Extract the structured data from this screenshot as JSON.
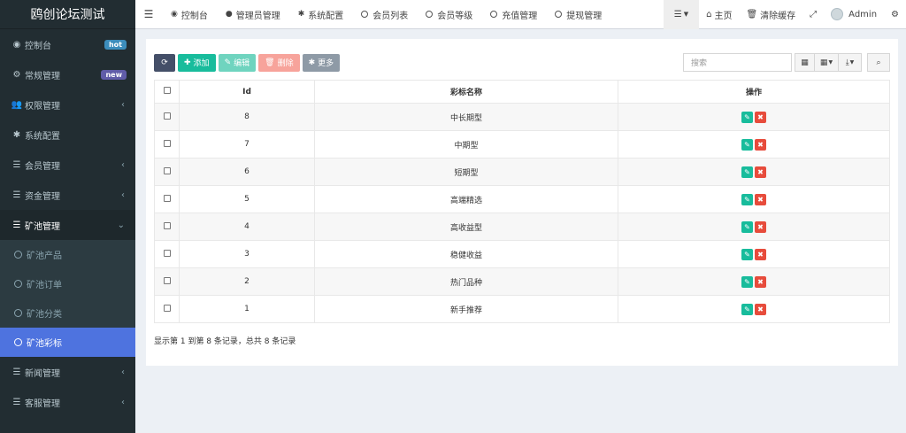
{
  "app": {
    "title": "鸥创论坛测试"
  },
  "sidebar": {
    "items": [
      {
        "label": "控制台",
        "icon": "dashboard-icon",
        "badge": "hot"
      },
      {
        "label": "常规管理",
        "icon": "cogs-icon",
        "badge": "new"
      },
      {
        "label": "权限管理",
        "icon": "users-icon",
        "arrow": "‹"
      },
      {
        "label": "系统配置",
        "icon": "gear-icon"
      },
      {
        "label": "会员管理",
        "icon": "list-icon",
        "arrow": "‹"
      },
      {
        "label": "资金管理",
        "icon": "list-icon",
        "arrow": "‹"
      },
      {
        "label": "矿池管理",
        "icon": "list-icon",
        "arrow": "⌄"
      }
    ],
    "submenu": [
      {
        "label": "矿池产品"
      },
      {
        "label": "矿池订单"
      },
      {
        "label": "矿池分类"
      },
      {
        "label": "矿池彩标"
      }
    ],
    "bottom_items": [
      {
        "label": "新闻管理",
        "icon": "list-icon",
        "arrow": "‹"
      },
      {
        "label": "客服管理",
        "icon": "list-icon",
        "arrow": "‹"
      }
    ]
  },
  "topnav": {
    "tabs": [
      {
        "label": "控制台",
        "icon": "dashboard-icon"
      },
      {
        "label": "管理员管理",
        "icon": "user-icon"
      },
      {
        "label": "系统配置",
        "icon": "gear-icon"
      },
      {
        "label": "会员列表",
        "icon": "circle-icon"
      },
      {
        "label": "会员等级",
        "icon": "circle-icon"
      },
      {
        "label": "充值管理",
        "icon": "circle-icon"
      },
      {
        "label": "提现管理",
        "icon": "circle-icon"
      }
    ],
    "right": {
      "home": "主页",
      "clear_cache": "清除缓存",
      "user": "Admin"
    }
  },
  "toolbar": {
    "add": "添加",
    "edit": "编辑",
    "delete": "删除",
    "more": "更多",
    "search_placeholder": "搜索"
  },
  "table": {
    "columns": [
      "Id",
      "彩标名称",
      "操作"
    ],
    "rows": [
      {
        "id": "8",
        "name": "中长期型"
      },
      {
        "id": "7",
        "name": "中期型"
      },
      {
        "id": "6",
        "name": "短期型"
      },
      {
        "id": "5",
        "name": "高端精选"
      },
      {
        "id": "4",
        "name": "高收益型"
      },
      {
        "id": "3",
        "name": "稳健收益"
      },
      {
        "id": "2",
        "name": "热门品种"
      },
      {
        "id": "1",
        "name": "新手推荐"
      }
    ]
  },
  "summary": "显示第 1 到第 8 条记录，总共 8 条记录",
  "colors": {
    "sidebar_bg": "#222d32",
    "active": "#4e73df",
    "success": "#18bc9c",
    "danger": "#e74c3c",
    "hot_badge": "#3c8dbc",
    "new_badge": "#605ca8"
  }
}
